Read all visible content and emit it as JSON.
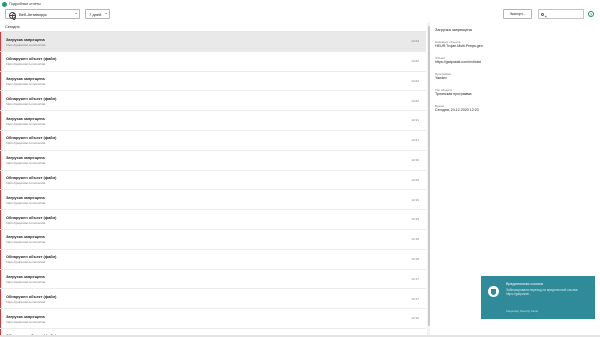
{
  "window": {
    "title": "Подробные отчеты"
  },
  "toolbar": {
    "source_select": "Веб-Антивирус",
    "period_select": "7 дней",
    "export_button": "Экспорт...",
    "search_placeholder": "",
    "help_label": "?"
  },
  "list": {
    "group_header": "Сегодня",
    "rows": [
      {
        "event": "Загрузка запрещена",
        "url": "https://gatposlat.com/ext/stat",
        "time": "12:23",
        "selected": true
      },
      {
        "event": "Обнаружен объект (файл)",
        "url": "https://gatposlat.com/ext/stat",
        "time": "12:22",
        "selected": false
      },
      {
        "event": "Загрузка запрещена",
        "url": "https://gatposlat.com/ext/stat",
        "time": "12:22",
        "selected": false
      },
      {
        "event": "Обнаружен объект (файл)",
        "url": "https://gatposlat.com/ext/stat",
        "time": "12:22",
        "selected": false
      },
      {
        "event": "Загрузка запрещена",
        "url": "https://gatposlat.com/ext/stat",
        "time": "12:21",
        "selected": false
      },
      {
        "event": "Обнаружен объект (файл)",
        "url": "https://gatposlat.com/ext/stat",
        "time": "12:21",
        "selected": false
      },
      {
        "event": "Загрузка запрещена",
        "url": "https://gatposlat.com/ext/stat",
        "time": "12:20",
        "selected": false
      },
      {
        "event": "Обнаружен объект (файл)",
        "url": "https://gatposlat.com/ext/stat",
        "time": "12:20",
        "selected": false
      },
      {
        "event": "Загрузка запрещена",
        "url": "https://gatposlat.com/ext/stat",
        "time": "12:19",
        "selected": false
      },
      {
        "event": "Обнаружен объект (файл)",
        "url": "https://gatposlat.com/ext/stat",
        "time": "12:19",
        "selected": false
      },
      {
        "event": "Загрузка запрещена",
        "url": "https://gatposlat.com/ext/stat",
        "time": "12:18",
        "selected": false
      },
      {
        "event": "Обнаружен объект (файл)",
        "url": "https://gatposlat.com/ext/stat",
        "time": "12:18",
        "selected": false
      },
      {
        "event": "Загрузка запрещена",
        "url": "https://gatposlat.com/ext/stat",
        "time": "12:17",
        "selected": false
      },
      {
        "event": "Обнаружен объект (файл)",
        "url": "https://gatposlat.com/ext/stat",
        "time": "12:17",
        "selected": false
      },
      {
        "event": "Загрузка запрещена",
        "url": "https://gatposlat.com/ext/stat",
        "time": "12:16",
        "selected": false
      },
      {
        "event": "Обнаружен объект (файл)",
        "url": "https://gatposlat.com/ext/stat",
        "time": "12:16",
        "selected": false
      }
    ]
  },
  "details": {
    "title": "Загрузка запрещена",
    "fields": [
      {
        "label": "Название объекта",
        "value": "HEUR:Trojan.Multi.Preqw.gen"
      },
      {
        "label": "Объект",
        "value": "https://gatposlat.com/ext/stat"
      },
      {
        "label": "Программа",
        "value": "Yandex"
      },
      {
        "label": "Тип объекта",
        "value": "Троянская программа"
      },
      {
        "label": "Время",
        "value": "Сегодня, 24.12.2020 12:23"
      }
    ]
  },
  "toast": {
    "title": "Вредоносная ссылка",
    "body": "Заблокирована переход по вредоносной ссылке https://gatposlat...",
    "footer": "Kaspersky Security Cloud"
  },
  "colors": {
    "alert_bar": "#d9363e",
    "toast_bg": "#2f8a99",
    "brand": "#1aa06d"
  }
}
